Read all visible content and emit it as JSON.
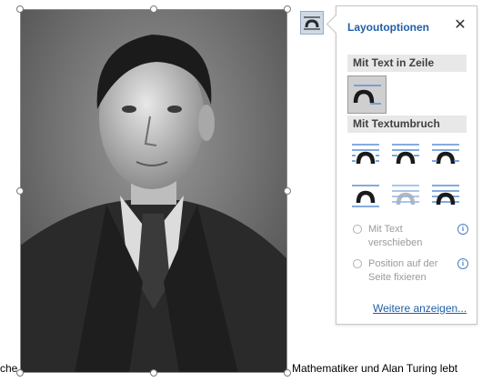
{
  "document": {
    "text_left": "che",
    "text_right": "Mathematiker und Alan Turing lebt"
  },
  "image": {
    "icon": "portrait-photo",
    "description_tone": "black-and-white"
  },
  "layout_button": {
    "icon": "layout-options-icon"
  },
  "panel": {
    "title": "Layoutoptionen",
    "close_label": "✕",
    "section_inline": "Mit Text in Zeile",
    "section_wrap": "Mit Textumbruch",
    "inline_options": [
      {
        "icon": "inline-with-text-icon",
        "selected": true
      }
    ],
    "wrap_options": [
      {
        "icon": "wrap-square-icon"
      },
      {
        "icon": "wrap-tight-icon"
      },
      {
        "icon": "wrap-through-icon"
      },
      {
        "icon": "wrap-top-bottom-icon"
      },
      {
        "icon": "wrap-behind-text-icon"
      },
      {
        "icon": "wrap-in-front-icon"
      }
    ],
    "radio_move": {
      "label": "Mit Text verschieben",
      "checked": false,
      "enabled": false
    },
    "radio_fix": {
      "label": "Position auf der Seite fixieren",
      "checked": false,
      "enabled": false
    },
    "info_glyph": "i",
    "more_link": "Weitere anzeigen..."
  },
  "colors": {
    "accent": "#1f5fa8",
    "section_bg": "#e8e8e8",
    "selected_bg": "#cfcfcf",
    "line_blue": "#5b8fd6"
  }
}
